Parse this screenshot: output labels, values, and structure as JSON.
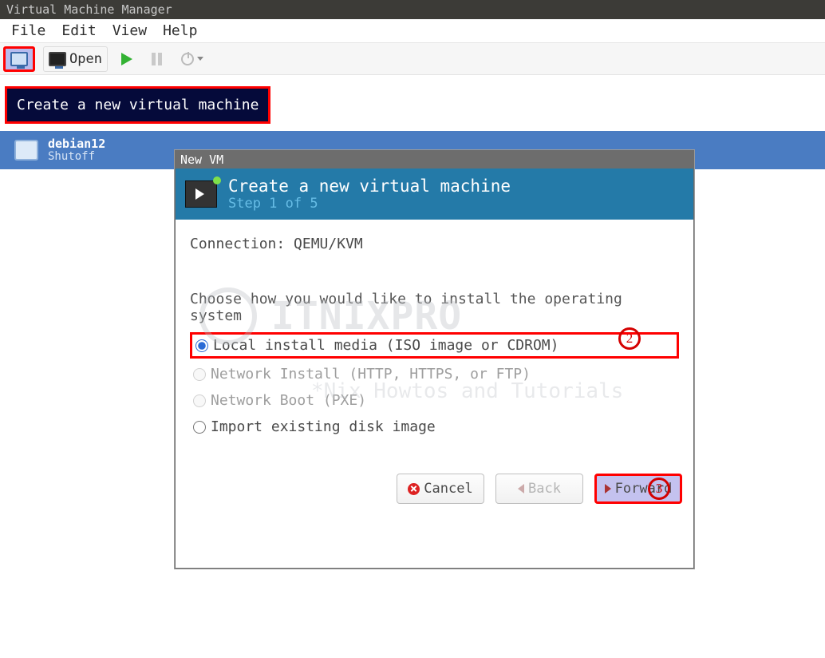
{
  "window_title": "Virtual Machine Manager",
  "menubar": {
    "file": "File",
    "edit": "Edit",
    "view": "View",
    "help": "Help"
  },
  "toolbar": {
    "open": "Open"
  },
  "tooltip": {
    "new_vm": "Create a new virtual machine"
  },
  "vm_list": {
    "items": [
      {
        "name": "debian12",
        "status": "Shutoff"
      }
    ]
  },
  "wizard": {
    "dialog_title": "New VM",
    "heading": "Create a new virtual machine",
    "step": "Step 1 of 5",
    "connection_label": "Connection: QEMU/KVM",
    "choose_label": "Choose how you would like to install the operating system",
    "options": {
      "local": "Local install media (ISO image or CDROM)",
      "net": "Network Install (HTTP, HTTPS, or FTP)",
      "pxe": "Network Boot (PXE)",
      "import": "Import existing disk image"
    },
    "buttons": {
      "cancel": "Cancel",
      "back": "Back",
      "forward": "Forward"
    },
    "annotations": {
      "opt": "2",
      "fwd": "3"
    }
  },
  "watermark": {
    "brand": "ITNIXPRO",
    "sub": "*Nix Howtos and Tutorials"
  }
}
